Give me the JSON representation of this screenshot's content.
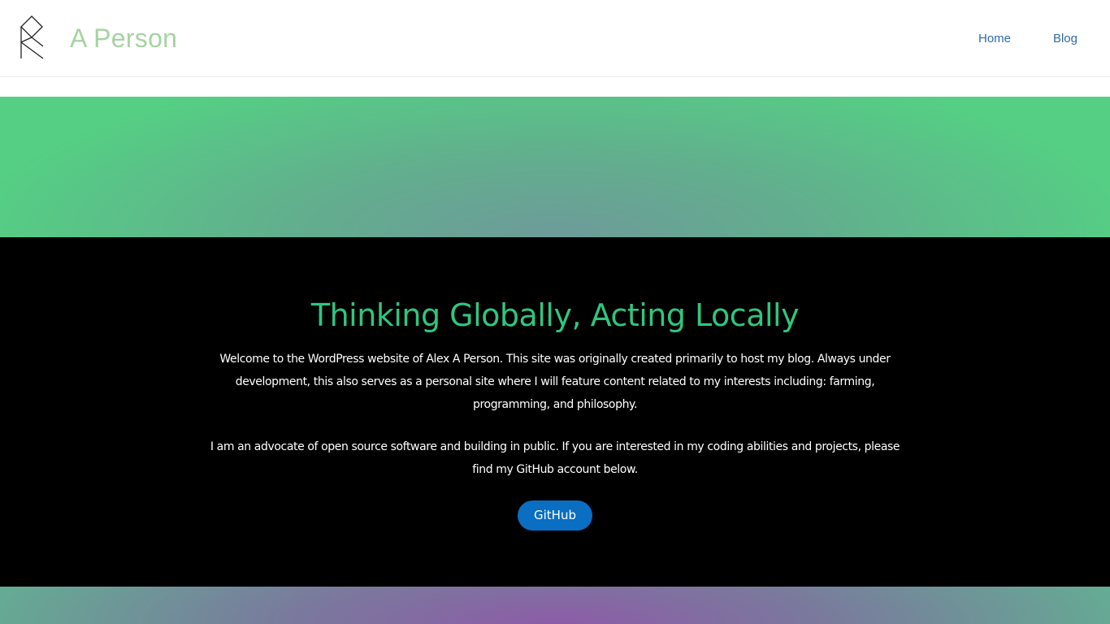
{
  "header": {
    "site_title": "A Person",
    "logo_icon": "geometric-monogram-icon",
    "nav": {
      "home": "Home",
      "blog": "Blog"
    }
  },
  "hero": {
    "heading": "Thinking Globally, Acting Locally",
    "paragraph_1": "Welcome to the WordPress website of Alex A Person. This site was originally created primarily to host my blog. Always under development, this also serves as a personal site where I will feature content related to my interests including: farming, programming, and philosophy.",
    "paragraph_2": "I am an advocate of open source software and building in public. If you are interested in my coding abilities and projects, please find my GitHub account below.",
    "button_label": "GitHub"
  },
  "colors": {
    "site_title": "#a6d3a1",
    "nav_link": "#2e6da4",
    "heading": "#2fc67f",
    "button": "#0a6ec2",
    "intro_background": "#000000",
    "top_band_center": "#6e9b9a",
    "top_band_edge": "#55cf84",
    "bottom_band_center": "#8d5ca8",
    "bottom_band_edge": "#64ad93"
  }
}
